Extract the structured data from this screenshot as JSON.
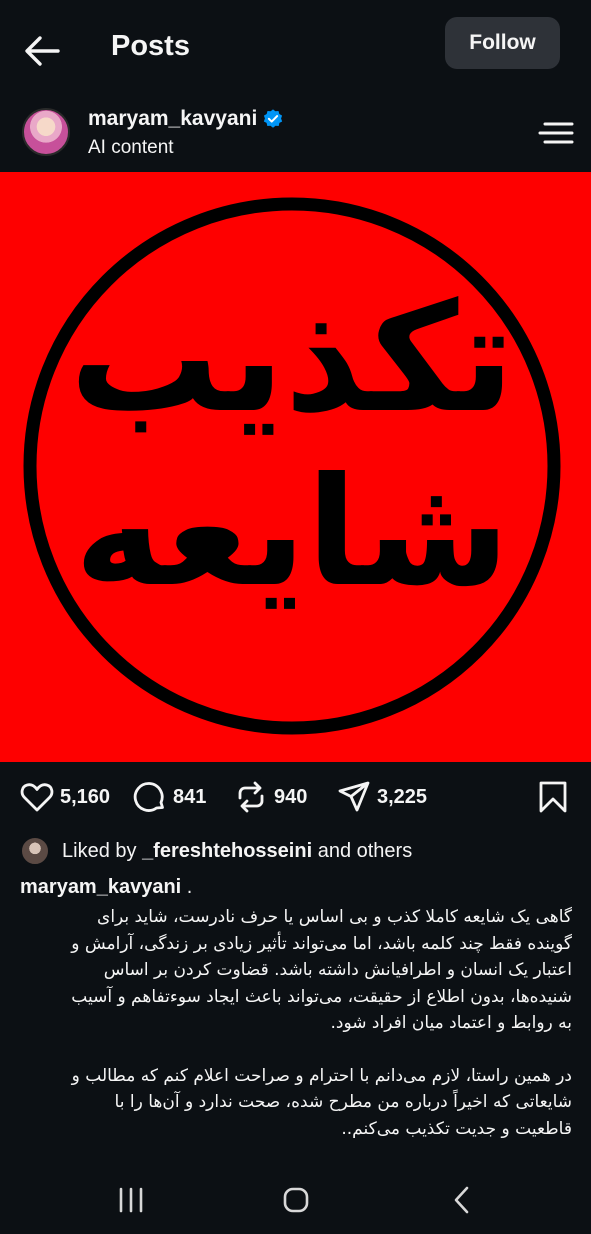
{
  "header": {
    "title": "Posts",
    "follow_label": "Follow",
    "back_icon": "arrow-left-icon"
  },
  "author": {
    "username": "maryam_kavyani",
    "verified": true,
    "subtitle": "AI content"
  },
  "post_image": {
    "line1": "تکذیب",
    "line2": "شایعه",
    "background_color": "#fe0000",
    "ink_color": "#000000"
  },
  "actions": {
    "likes": "5,160",
    "comments": "841",
    "reposts": "940",
    "shares": "3,225"
  },
  "liked_by": {
    "prefix": "Liked by ",
    "user": "_fereshtehosseini",
    "suffix": " and others"
  },
  "caption": {
    "username": "maryam_kavyani",
    "separator": " .",
    "lines": [
      "گاهی یک شایعه کاملا کذب و بی اساس یا حرف نادرست، شاید برای",
      "گوینده فقط چند کلمه باشد، اما می‌تواند تأثیر زیادی بر زندگی، آرامش و",
      "اعتبار یک انسان و اطرافیانش داشته باشد. قضاوت کردن بر اساس",
      "شنیده‌ها، بدون اطلاع از حقیقت، می‌تواند باعث ایجاد سوءتفاهم و آسیب",
      "به روابط و اعتماد میان افراد شود."
    ],
    "lines2": [
      "در همین راستا، لازم می‌دانم با احترام و صراحت اعلام کنم که مطالب و",
      "شایعاتی که اخیراً درباره من مطرح شده، صحت ندارد و آن‌ها را با",
      "قاطعیت و جدیت تکذیب می‌کنم.."
    ]
  },
  "colors": {
    "background": "#0c1014",
    "text": "#f5f5f5",
    "follow_button": "#2e3238",
    "verified": "#0095f6"
  }
}
